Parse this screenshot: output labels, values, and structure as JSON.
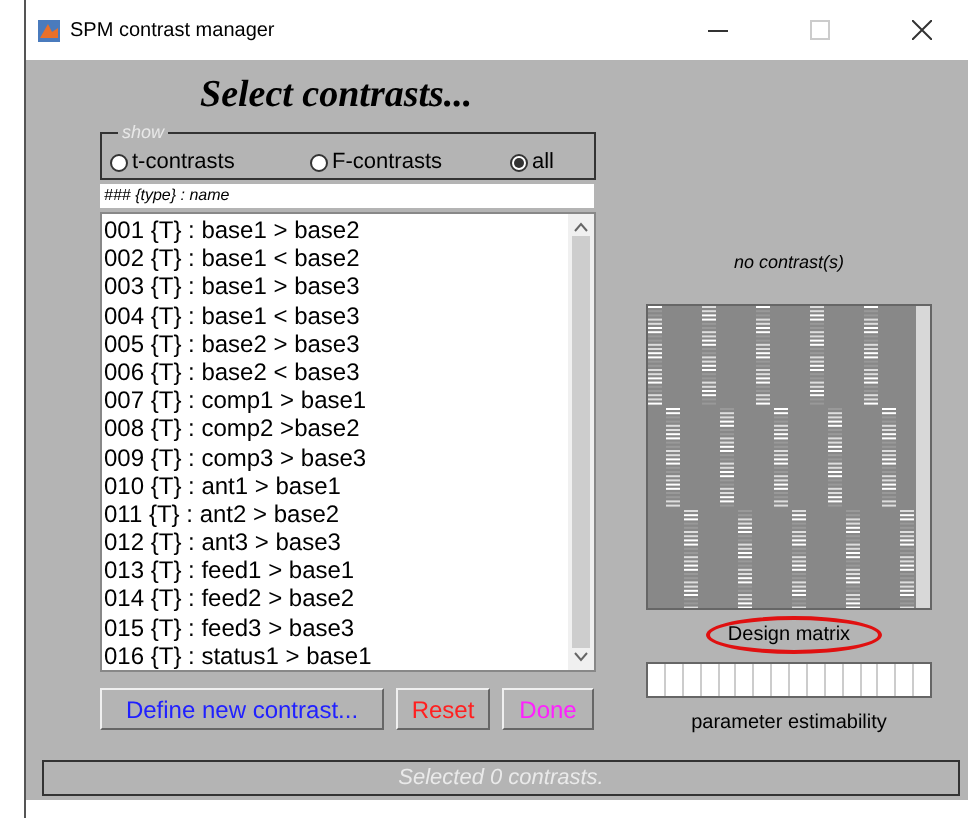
{
  "window": {
    "title": "SPM contrast manager"
  },
  "heading": "Select contrasts...",
  "show": {
    "legend": "show",
    "options": [
      {
        "label": "t-contrasts",
        "selected": false
      },
      {
        "label": "F-contrasts",
        "selected": false
      },
      {
        "label": "all",
        "selected": true
      }
    ]
  },
  "list_header": "### {type} : name",
  "contrasts": [
    {
      "label": "001 {T} : base1 > base2",
      "selected": false
    },
    {
      "label": "002 {T} : base1 < base2",
      "selected": false
    },
    {
      "label": "003 {T} : base1 > base3",
      "selected": false
    },
    {
      "label": "004 {T} : base1 < base3",
      "selected": false
    },
    {
      "label": "005 {T} : base2 > base3",
      "selected": false
    },
    {
      "label": "006 {T} : base2 < base3",
      "selected": false
    },
    {
      "label": "007 {T} : comp1 > base1",
      "selected": false
    },
    {
      "label": "008 {T} : comp2 >base2",
      "selected": false
    },
    {
      "label": "009 {T} : comp3 > base3",
      "selected": false
    },
    {
      "label": "010 {T} : ant1 > base1",
      "selected": false
    },
    {
      "label": "011 {T} : ant2 > base2",
      "selected": false
    },
    {
      "label": "012 {T} : ant3 > base3",
      "selected": false
    },
    {
      "label": "013 {T} : feed1 > base1",
      "selected": false
    },
    {
      "label": "014 {T} : feed2 > base2",
      "selected": false
    },
    {
      "label": "015 {T} : feed3 > base3",
      "selected": false
    },
    {
      "label": "016 {T} : status1 > base1",
      "selected": false
    }
  ],
  "buttons": [
    {
      "label": "Define new contrast...",
      "color": "#2020ff"
    },
    {
      "label": "Reset",
      "color": "#ff2020"
    },
    {
      "label": "Done",
      "color": "#ff20ff"
    }
  ],
  "contrast_caption": "no contrast(s)",
  "design_matrix_label": {
    "text": "Design matrix",
    "highlighted": true
  },
  "estimability_caption": "parameter estimability",
  "status_bar": "Selected 0 contrasts."
}
